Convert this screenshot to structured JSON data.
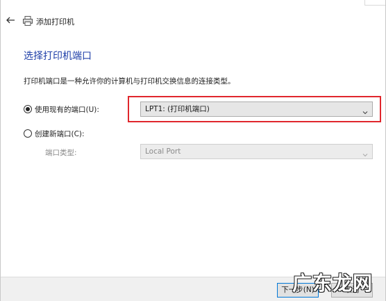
{
  "window": {
    "title": "添加打印机"
  },
  "page": {
    "heading": "选择打印机端口",
    "description": "打印机端口是一种允许你的计算机与打印机交换信息的连接类型。"
  },
  "options": {
    "existing": {
      "label": "使用现有的端口(U):",
      "selected": true,
      "value": "LPT1: (打印机端口)"
    },
    "create": {
      "label": "创建新端口(C):",
      "selected": false,
      "type_label": "端口类型:",
      "type_value": "Local Port"
    }
  },
  "buttons": {
    "next": "下一步(N)",
    "cancel": "取消"
  },
  "watermark": "广东龙网",
  "colors": {
    "heading": "#1f3fa8",
    "highlight": "#e0262c",
    "primary_border": "#0078d7"
  }
}
